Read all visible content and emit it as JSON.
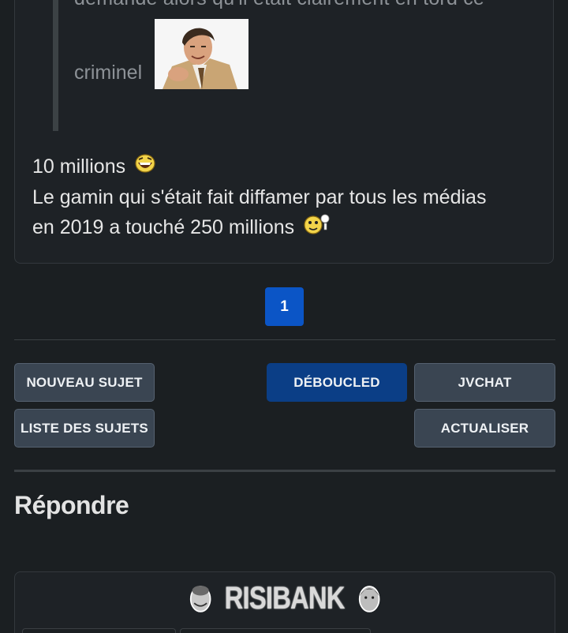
{
  "post": {
    "quote_line_1": "demande alors qu'il était clairement en tord ce",
    "quote_line_2": "criminel",
    "line_1": "10 millions",
    "line_2": "Le gamin qui s'était fait diffamer par tous les médias",
    "line_3": "en 2019 a touché 250 millions"
  },
  "pagination": {
    "current_page": "1"
  },
  "actions": {
    "nouveau_sujet": "NOUVEAU SUJET",
    "liste_sujets": "LISTE DES SUJETS",
    "deboucled": "DÉBOUCLED",
    "jvchat": "JVCHAT",
    "actualiser": "ACTUALISER"
  },
  "reply": {
    "title": "Répondre",
    "risibank": "RISIBANK"
  },
  "colors": {
    "background": "#1b1f22",
    "page_active": "#0b55c6",
    "deboucled": "#0b3e86",
    "button_grey": "#3a4552"
  }
}
